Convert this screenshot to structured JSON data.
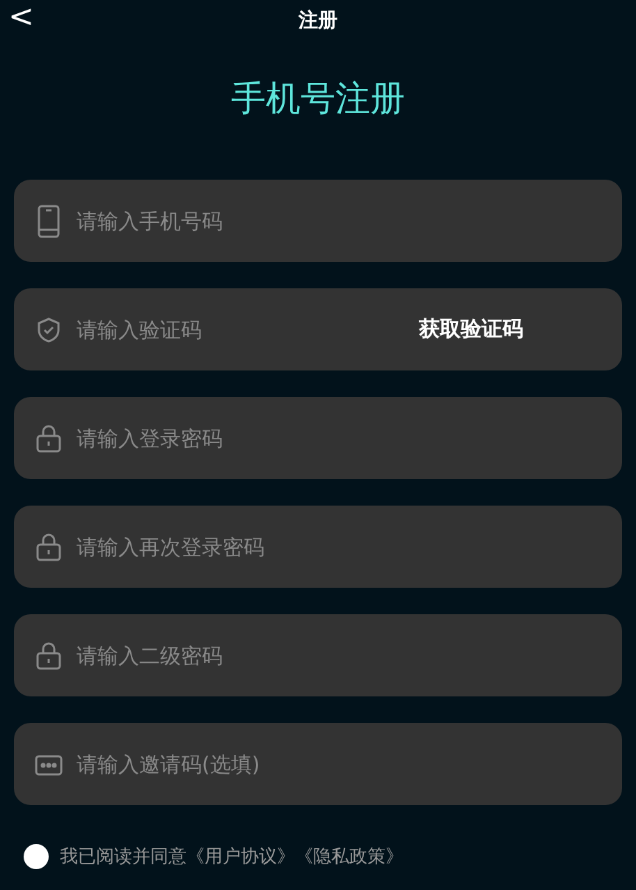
{
  "header": {
    "back": "<",
    "title": "注册"
  },
  "heading": "手机号注册",
  "fields": [
    {
      "kind": "phone",
      "placeholder": "请输入手机号码"
    },
    {
      "kind": "shield",
      "placeholder": "请输入验证码",
      "action": "获取验证码"
    },
    {
      "kind": "lock",
      "placeholder": "请输入登录密码"
    },
    {
      "kind": "lock",
      "placeholder": "请输入再次登录密码"
    },
    {
      "kind": "lock",
      "placeholder": "请输入二级密码"
    },
    {
      "kind": "dots",
      "placeholder": "请输入邀请码(选填)"
    }
  ],
  "agreement": {
    "checked": false,
    "text": "我已阅读并同意",
    "links": [
      "《用户协议》",
      "《隐私政策》"
    ]
  }
}
